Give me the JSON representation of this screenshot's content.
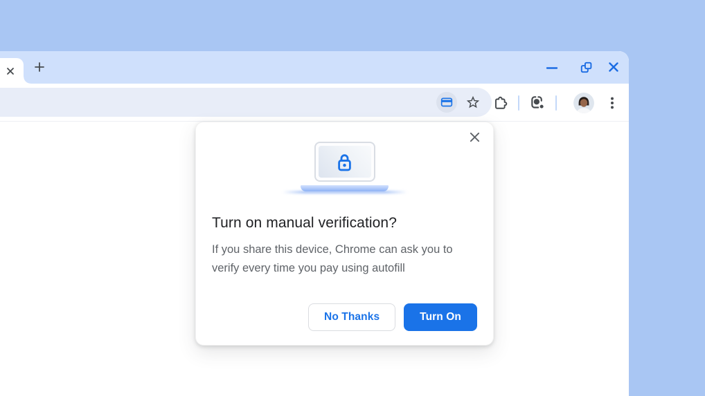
{
  "theme": {
    "desktop_bg": "#a9c6f3",
    "tabstrip_bg": "#cfe0fc",
    "omnibox_bg": "#e8edf8",
    "toolbar_bg": "#ffffff",
    "accent_blue": "#1a73e8",
    "window_control_blue": "#1b6ce3",
    "icon_gray": "#474b4f",
    "title_color": "#202124",
    "body_color": "#5f6368",
    "button_border": "#dadce0",
    "separator_blue": "#c3d8f9"
  },
  "window": {
    "tabstrip": {
      "active_tab_icon": "tab-close-icon",
      "new_tab_icon": "plus-icon"
    },
    "controls": [
      "minimize-icon",
      "restore-window-icon",
      "close-window-icon"
    ]
  },
  "toolbar": {
    "omnibox_icons": [
      "payment-card-icon",
      "star-icon"
    ],
    "right_icons": [
      "extensions-puzzle-icon",
      "lens-camera-icon",
      "profile-avatar",
      "more-vert-icon"
    ]
  },
  "dialog": {
    "close_icon": "close-x-icon",
    "illustration": "laptop-with-lock",
    "title": "Turn on manual verification?",
    "body": "If you share this device, Chrome can ask you to verify every time you pay using autofill",
    "secondary_button": "No Thanks",
    "primary_button": "Turn On"
  }
}
